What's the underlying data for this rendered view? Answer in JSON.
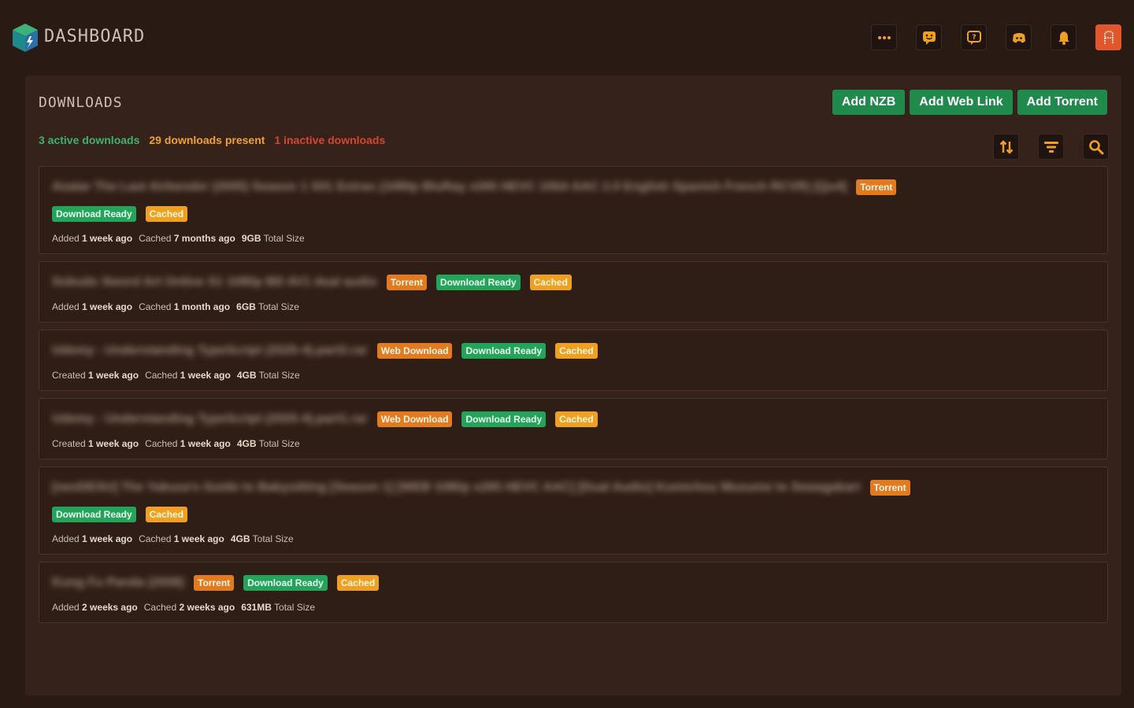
{
  "header": {
    "brand": "DASHBOARD",
    "icons": [
      "more-icon",
      "chat-icon",
      "support-icon",
      "discord-icon",
      "bell-icon",
      "avatar"
    ],
    "accent": "#e2562c"
  },
  "panel": {
    "title": "DOWNLOADS",
    "actions": {
      "add_nzb": "Add NZB",
      "add_web_link": "Add Web Link",
      "add_torrent": "Add Torrent"
    },
    "stats": {
      "active": "3 active downloads",
      "present": "29 downloads present",
      "inactive": "1 inactive downloads"
    },
    "tools": [
      "sort-icon",
      "filter-icon",
      "search-icon"
    ]
  },
  "downloads": [
    {
      "name": "Avatar The Last Airbender (2005) Season 1 S01 Extras (1080p BluRay x265 HEVC 10bit AAC 2.0 English Spanish French RCVR) [Qu4]",
      "type": "Torrent",
      "ready": "Download Ready",
      "cached": "Cached",
      "added_label": "Added",
      "added": "1 week ago",
      "cached_label": "Cached",
      "cached_ago": "7 months ago",
      "size": "9GB",
      "size_label": "Total Size"
    },
    {
      "name": "Sokudo Sword Art Online S1 1080p BD AV1 dual audio",
      "type": "Torrent",
      "ready": "Download Ready",
      "cached": "Cached",
      "added_label": "Added",
      "added": "1 week ago",
      "cached_label": "Cached",
      "cached_ago": "1 month ago",
      "size": "6GB",
      "size_label": "Total Size"
    },
    {
      "name": "Udemy - Understanding TypeScript (2025-4).part2.rar",
      "type": "Web Download",
      "ready": "Download Ready",
      "cached": "Cached",
      "added_label": "Created",
      "added": "1 week ago",
      "cached_label": "Cached",
      "cached_ago": "1 week ago",
      "size": "4GB",
      "size_label": "Total Size"
    },
    {
      "name": "Udemy - Understanding TypeScript (2025-4).part1.rar",
      "type": "Web Download",
      "ready": "Download Ready",
      "cached": "Cached",
      "added_label": "Created",
      "added": "1 week ago",
      "cached_label": "Cached",
      "cached_ago": "1 week ago",
      "size": "4GB",
      "size_label": "Total Size"
    },
    {
      "name": "[neoDESU] The Yakuza's Guide to Babysitting [Season 1] [WEB 1080p x265 HEVC AAC] [Dual Audio] Kumichou Musume to Sewagakari",
      "type": "Torrent",
      "ready": "Download Ready",
      "cached": "Cached",
      "added_label": "Added",
      "added": "1 week ago",
      "cached_label": "Cached",
      "cached_ago": "1 week ago",
      "size": "4GB",
      "size_label": "Total Size"
    },
    {
      "name": "Kung Fu Panda (2008)",
      "type": "Torrent",
      "ready": "Download Ready",
      "cached": "Cached",
      "added_label": "Added",
      "added": "2 weeks ago",
      "cached_label": "Cached",
      "cached_ago": "2 weeks ago",
      "size": "631MB",
      "size_label": "Total Size"
    }
  ]
}
